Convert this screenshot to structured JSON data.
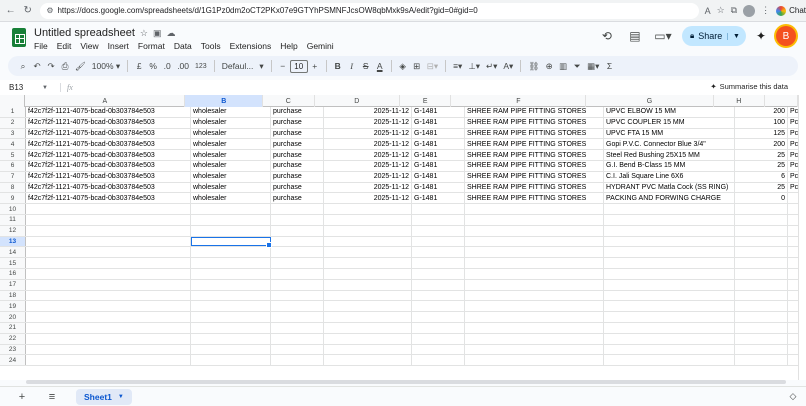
{
  "browser": {
    "url": "https://docs.google.com/spreadsheets/d/1G1Pz0dm2oCT2PKx07e9GTYhPSMNFJcsOW8qbMxk9sA/edit?gid=0#gid=0",
    "chat_label": "Chat"
  },
  "doc": {
    "title": "Untitled spreadsheet"
  },
  "menu": [
    "File",
    "Edit",
    "View",
    "Insert",
    "Format",
    "Data",
    "Tools",
    "Extensions",
    "Help",
    "Gemini"
  ],
  "share_label": "Share",
  "user_initial": "B",
  "toolbar": {
    "zoom": "100%",
    "currency": "£",
    "percent": "%",
    "dec_decrease": ".0",
    "dec_increase": ".00",
    "number_format": "123",
    "font": "Defaul...",
    "font_size": "10"
  },
  "formula_bar": {
    "name_box": "B13",
    "fx": "fx",
    "summarise_label": "Summarise this data"
  },
  "grid": {
    "columns": [
      "A",
      "B",
      "C",
      "D",
      "E",
      "F",
      "G",
      "H"
    ],
    "selected_column": "B",
    "selected_row": "13",
    "row_numbers": [
      "1",
      "2",
      "3",
      "4",
      "5",
      "6",
      "7",
      "8",
      "9",
      "10",
      "11",
      "12",
      "13",
      "14",
      "15",
      "16",
      "17",
      "18",
      "19",
      "20",
      "21",
      "22",
      "23",
      "24"
    ],
    "rows": [
      [
        "f42c7f2f-1121-4075-bcad-0b303784e503",
        "wholesaler",
        "purchase",
        "2025-11-12",
        "G-1481",
        "SHREE RAM PIPE FITTING STORES",
        "UPVC ELBOW 15 MM",
        "200",
        "Pc"
      ],
      [
        "f42c7f2f-1121-4075-bcad-0b303784e503",
        "wholesaler",
        "purchase",
        "2025-11-12",
        "G-1481",
        "SHREE RAM PIPE FITTING STORES",
        "UPVC COUPLER 15 MM",
        "100",
        "Pc"
      ],
      [
        "f42c7f2f-1121-4075-bcad-0b303784e503",
        "wholesaler",
        "purchase",
        "2025-11-12",
        "G-1481",
        "SHREE RAM PIPE FITTING STORES",
        "UPVC FTA 15 MM",
        "125",
        "Pc"
      ],
      [
        "f42c7f2f-1121-4075-bcad-0b303784e503",
        "wholesaler",
        "purchase",
        "2025-11-12",
        "G-1481",
        "SHREE RAM PIPE FITTING STORES",
        "Gopi P.V.C. Connector Blue 3/4\"",
        "200",
        "Pc"
      ],
      [
        "f42c7f2f-1121-4075-bcad-0b303784e503",
        "wholesaler",
        "purchase",
        "2025-11-12",
        "G-1481",
        "SHREE RAM PIPE FITTING STORES",
        "Steel Red Bushing 25X15 MM",
        "25",
        "Pc"
      ],
      [
        "f42c7f2f-1121-4075-bcad-0b303784e503",
        "wholesaler",
        "purchase",
        "2025-11-12",
        "G-1481",
        "SHREE RAM PIPE FITTING STORES",
        "G.I. Bend B-Class 15 MM",
        "25",
        "Pc"
      ],
      [
        "f42c7f2f-1121-4075-bcad-0b303784e503",
        "wholesaler",
        "purchase",
        "2025-11-12",
        "G-1481",
        "SHREE RAM PIPE FITTING STORES",
        "C.I. Jali Square Line 6X6",
        "6",
        "Pc"
      ],
      [
        "f42c7f2f-1121-4075-bcad-0b303784e503",
        "wholesaler",
        "purchase",
        "2025-11-12",
        "G-1481",
        "SHREE RAM PIPE FITTING STORES",
        "HYDRANT PVC Matla Cock (SS RING)",
        "25",
        "Pc"
      ],
      [
        "f42c7f2f-1121-4075-bcad-0b303784e503",
        "wholesaler",
        "purchase",
        "2025-11-12",
        "G-1481",
        "SHREE RAM PIPE FITTING STORES",
        "PACKING AND FORWING CHARGE",
        "0",
        ""
      ]
    ]
  },
  "sheet_tabs": {
    "active": "Sheet1"
  }
}
